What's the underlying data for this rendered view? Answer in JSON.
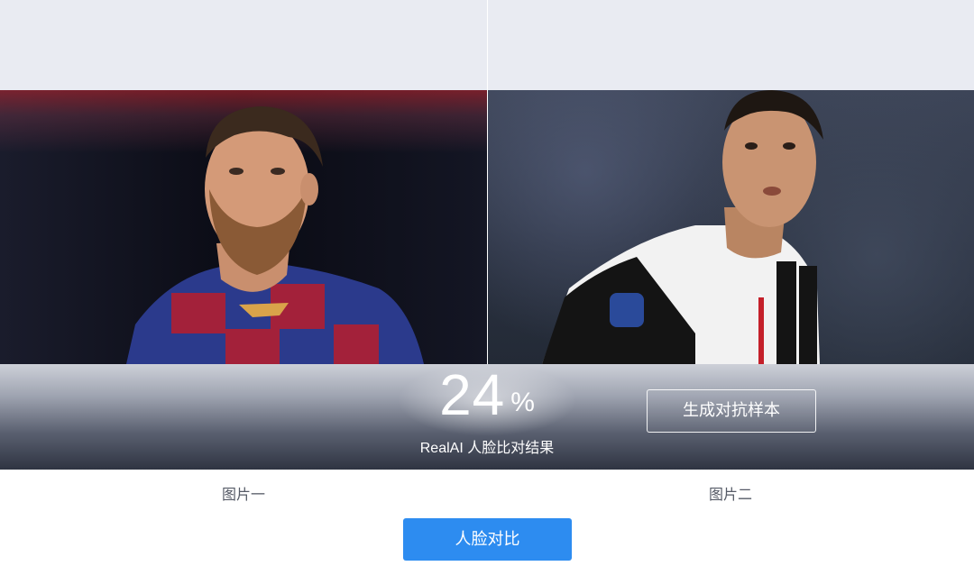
{
  "result": {
    "score_value": "24",
    "score_unit": "%",
    "label": "RealAI 人脸比对结果",
    "generate_button_label": "生成对抗样本"
  },
  "images": {
    "left_caption": "图片一",
    "right_caption": "图片二"
  },
  "actions": {
    "compare_button_label": "人脸对比"
  },
  "colors": {
    "primary_button": "#2d8cf0",
    "panel_top": "#e9ebf2"
  }
}
